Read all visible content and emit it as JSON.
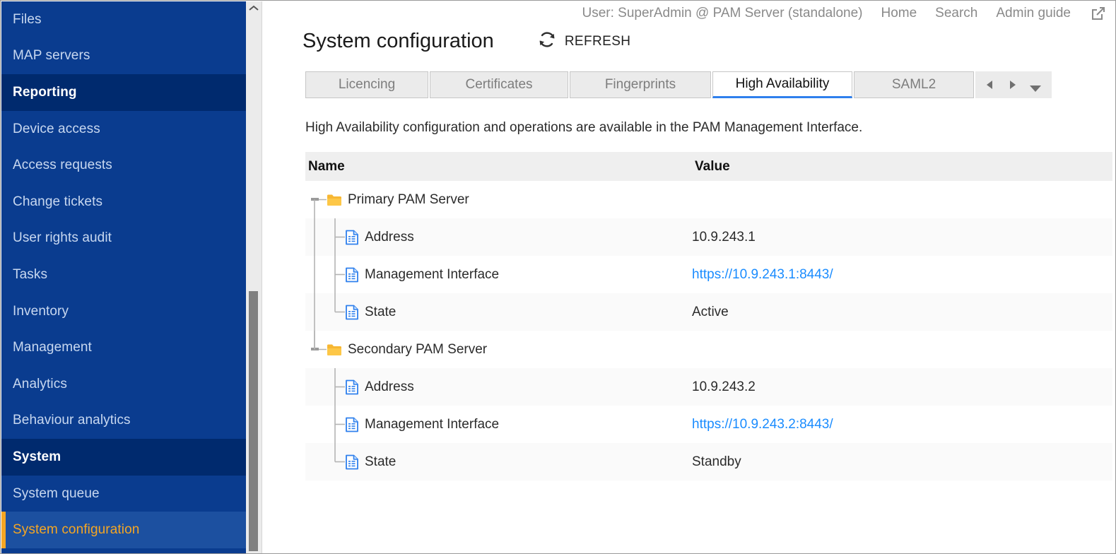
{
  "sidebar": {
    "items": [
      {
        "label": "Files",
        "type": "item"
      },
      {
        "label": "MAP servers",
        "type": "item"
      },
      {
        "label": "Reporting",
        "type": "group"
      },
      {
        "label": "Device access",
        "type": "item"
      },
      {
        "label": "Access requests",
        "type": "item"
      },
      {
        "label": "Change tickets",
        "type": "item"
      },
      {
        "label": "User rights audit",
        "type": "item"
      },
      {
        "label": "Tasks",
        "type": "item"
      },
      {
        "label": "Inventory",
        "type": "item"
      },
      {
        "label": "Management",
        "type": "item"
      },
      {
        "label": "Analytics",
        "type": "item"
      },
      {
        "label": "Behaviour analytics",
        "type": "item"
      },
      {
        "label": "System",
        "type": "group"
      },
      {
        "label": "System queue",
        "type": "item"
      },
      {
        "label": "System configuration",
        "type": "selected"
      }
    ],
    "scrollbar": {
      "up_icon": "chevron-up-icon"
    },
    "colors": {
      "background": "#0a3c8f",
      "group_background": "#002a6e",
      "selected_background": "#1c50a0",
      "selected_accent": "#f5a623",
      "item_text": "#c8d8f0"
    }
  },
  "topbar": {
    "user": "User: SuperAdmin @ PAM Server (standalone)",
    "links": [
      {
        "label": "Home"
      },
      {
        "label": "Search"
      },
      {
        "label": "Admin guide"
      }
    ],
    "external_icon": "external-link-icon"
  },
  "header": {
    "title": "System configuration",
    "refresh_label": "REFRESH",
    "refresh_icon": "refresh-icon"
  },
  "tabs": {
    "items": [
      {
        "label": "Licencing",
        "active": false
      },
      {
        "label": "Certificates",
        "active": false
      },
      {
        "label": "Fingerprints",
        "active": false
      },
      {
        "label": "High Availability",
        "active": true
      },
      {
        "label": "SAML2",
        "active": false
      }
    ],
    "nav": {
      "prev_icon": "triangle-left-icon",
      "next_icon": "triangle-right-icon",
      "dropdown_icon": "caret-down-icon"
    },
    "active_underline_color": "#2f80ed"
  },
  "content": {
    "description": "High Availability configuration and operations are available in the PAM Management Interface.",
    "table": {
      "columns": [
        "Name",
        "Value"
      ],
      "rows": [
        {
          "name": "Primary PAM Server",
          "value": "",
          "value_type": "none",
          "level": 0,
          "icon": "folder-icon",
          "shading": "plain"
        },
        {
          "name": "Address",
          "value": "10.9.243.1",
          "value_type": "text",
          "level": 1,
          "icon": "document-icon",
          "shading": "alt"
        },
        {
          "name": "Management Interface",
          "value": "https://10.9.243.1:8443/",
          "value_type": "link",
          "level": 1,
          "icon": "document-icon",
          "shading": "plain"
        },
        {
          "name": "State",
          "value": "Active",
          "value_type": "text",
          "level": 1,
          "icon": "document-icon",
          "shading": "alt"
        },
        {
          "name": "Secondary PAM Server",
          "value": "",
          "value_type": "none",
          "level": 0,
          "icon": "folder-icon",
          "shading": "plain"
        },
        {
          "name": "Address",
          "value": "10.9.243.2",
          "value_type": "text",
          "level": 1,
          "icon": "document-icon",
          "shading": "alt"
        },
        {
          "name": "Management Interface",
          "value": "https://10.9.243.2:8443/",
          "value_type": "link",
          "level": 1,
          "icon": "document-icon",
          "shading": "plain"
        },
        {
          "name": "State",
          "value": "Standby",
          "value_type": "text",
          "level": 1,
          "icon": "document-icon",
          "shading": "alt"
        }
      ],
      "link_color": "#1a8cff",
      "header_background": "#efefef"
    }
  }
}
